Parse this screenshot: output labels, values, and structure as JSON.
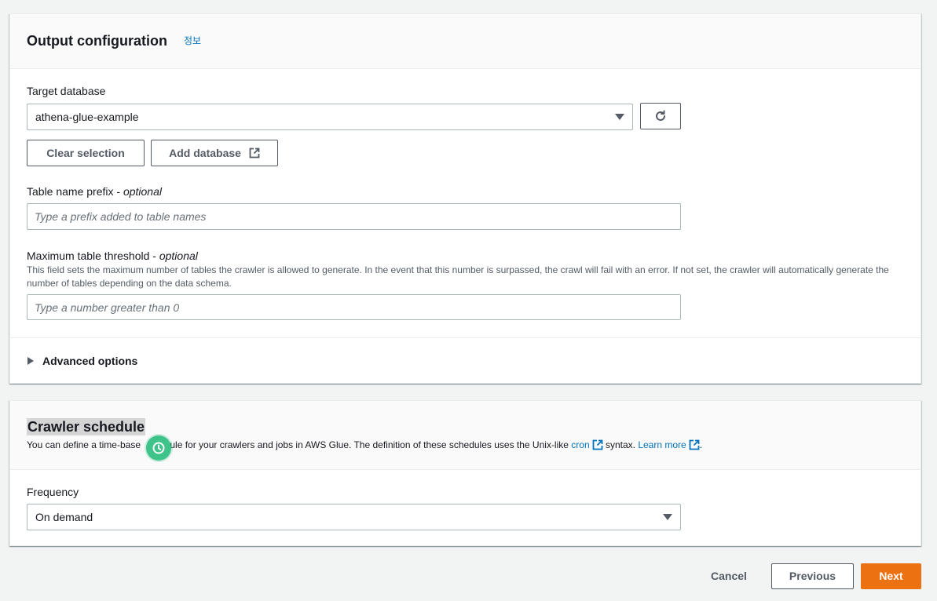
{
  "output": {
    "title": "Output configuration",
    "info": "정보",
    "target_db_label": "Target database",
    "target_db_value": "athena-glue-example",
    "clear_label": "Clear selection",
    "add_db_label": "Add database",
    "prefix_label": "Table name prefix - ",
    "prefix_optional": "optional",
    "prefix_placeholder": "Type a prefix added to table names",
    "threshold_label": "Maximum table threshold - ",
    "threshold_optional": "optional",
    "threshold_help": "This field sets the maximum number of tables the crawler is allowed to generate. In the event that this number is surpassed, the crawl will fail with an error. If not set, the crawler will automatically generate the number of tables depending on the data schema.",
    "threshold_placeholder": "Type a number greater than 0",
    "advanced_label": "Advanced options"
  },
  "schedule": {
    "title": "Crawler schedule",
    "desc_pre": "You can define a time-base",
    "desc_mid": "edule for your crawlers and jobs in AWS Glue. The definition of these schedules uses the Unix-like ",
    "cron_link": "cron",
    "desc_syntax": " syntax. ",
    "learn_more": "Learn more",
    "desc_end": ".",
    "frequency_label": "Frequency",
    "frequency_value": "On demand"
  },
  "footer": {
    "cancel": "Cancel",
    "previous": "Previous",
    "next": "Next"
  },
  "colors": {
    "accent": "#ec7211",
    "link": "#0073bb",
    "badge": "#3ec38a"
  },
  "icons": [
    "refresh-icon",
    "external-link-icon",
    "caret-down-icon",
    "caret-right-icon",
    "cursor-badge-icon"
  ]
}
